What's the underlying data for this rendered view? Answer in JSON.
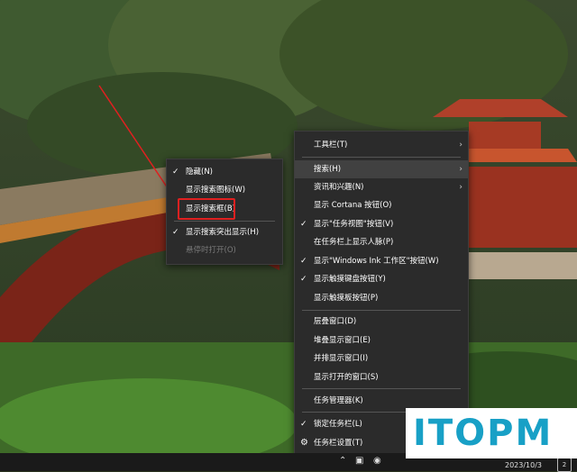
{
  "main_menu": {
    "items": [
      {
        "label": "工具栏(T)",
        "checked": false,
        "submenu": true
      },
      {
        "label": "搜索(H)",
        "checked": false,
        "submenu": true,
        "highlighted": true
      },
      {
        "label": "资讯和兴趣(N)",
        "checked": false,
        "submenu": true
      },
      {
        "label": "显示 Cortana 按钮(O)",
        "checked": false
      },
      {
        "label": "显示\"任务视图\"按钮(V)",
        "checked": true
      },
      {
        "label": "在任务栏上显示人脉(P)",
        "checked": false
      },
      {
        "label": "显示\"Windows Ink 工作区\"按钮(W)",
        "checked": true
      },
      {
        "label": "显示触摸键盘按钮(Y)",
        "checked": true
      },
      {
        "label": "显示触摸板按钮(P)",
        "checked": false
      },
      {
        "label": "层叠窗口(D)"
      },
      {
        "label": "堆叠显示窗口(E)"
      },
      {
        "label": "并排显示窗口(I)"
      },
      {
        "label": "显示打开的窗口(S)"
      },
      {
        "label": "任务管理器(K)"
      },
      {
        "label": "锁定任务栏(L)",
        "checked": true
      },
      {
        "label": "任务栏设置(T)",
        "icon": "gear-icon"
      }
    ]
  },
  "search_submenu": {
    "items": [
      {
        "label": "隐藏(N)",
        "checked": true
      },
      {
        "label": "显示搜索图标(W)",
        "checked": false
      },
      {
        "label": "显示搜索框(B)",
        "checked": false,
        "annotated": true
      },
      {
        "label": "显示搜索突出显示(H)",
        "checked": true
      },
      {
        "label": "悬停时打开(O)",
        "disabled": true
      }
    ]
  },
  "taskbar": {
    "date": "2023/10/3",
    "notification_count": "2"
  },
  "watermark": {
    "text": "ITOPM"
  },
  "colors": {
    "menu_bg": "#2b2b2b",
    "highlight": "#414141",
    "annotation_red": "#e02020",
    "logo_blue": "#18a0c6"
  }
}
